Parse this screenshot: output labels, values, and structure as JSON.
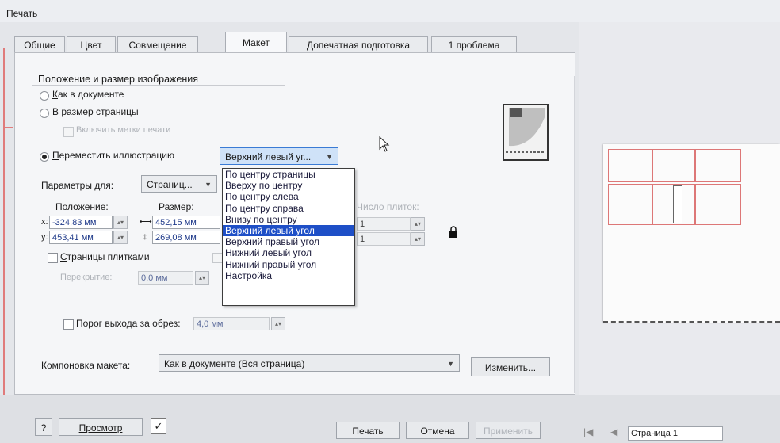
{
  "window": {
    "title": "Печать"
  },
  "tabs": [
    {
      "label": "Общие",
      "active": false
    },
    {
      "label": "Цвет",
      "active": false
    },
    {
      "label": "Совмещение",
      "active": false
    },
    {
      "label": "Макет",
      "active": true
    },
    {
      "label": "Допечатная подготовка",
      "active": false
    },
    {
      "label": "1 проблема",
      "active": false
    }
  ],
  "position_group": {
    "title": "Положение и размер изображения",
    "option_as_document": {
      "prefix": "",
      "underlined": "К",
      "rest": "ак в документе",
      "selected": false
    },
    "option_fit_page": {
      "underlined": "В",
      "rest": " размер страницы",
      "selected": false
    },
    "print_marks_checkbox": {
      "label": "Включить метки печати",
      "checked": false,
      "disabled": true
    },
    "option_move": {
      "underlined": "П",
      "rest": "ереместить иллюстрацию",
      "selected": true
    },
    "move_combo": {
      "value": "Верхний левый уг..."
    },
    "params_label": "Параметры для:",
    "params_combo": {
      "value": "Страниц..."
    },
    "position_label": "Положение:",
    "size_label": "Размер:",
    "x_label": "x:",
    "x_value": "-324,83 мм",
    "y_label": "y:",
    "y_value": "453,41 мм",
    "width_value": "452,15 мм",
    "height_value": "269,08 мм",
    "tiles_count_label": "Число плиток:",
    "tiles_value_1": "1",
    "tiles_value_2": "1",
    "tile_pages_checkbox": {
      "underlined": "С",
      "rest": "траницы плитками",
      "checked": false
    },
    "overlap_label": "Перекрытие:",
    "overlap_value": "0,0 мм"
  },
  "dropdown": {
    "items": [
      "По центру страницы",
      "Вверху по центру",
      "По центру слева",
      "По центру справа",
      "Внизу по центру",
      "Верхний левый угол",
      "Верхний правый угол",
      "Нижний левый угол",
      "Нижний правый угол",
      "Настройка"
    ],
    "highlighted_index": 5
  },
  "bleed": {
    "checkbox_label": "Порог выхода за обрез:",
    "checked": false,
    "value": "4,0 мм"
  },
  "layout": {
    "label": "Компоновка макета:",
    "value": "Как в документе (Вся страница)",
    "change_button": "Изменить..."
  },
  "footer": {
    "help_button": "?",
    "preview_button": "Просмотр",
    "print_button": "Печать",
    "cancel_button": "Отмена",
    "apply_button": "Применить",
    "page_selector": "Страница 1"
  },
  "colors": {
    "accent": "#1e4fc7",
    "preview_lines": "#d77777"
  }
}
